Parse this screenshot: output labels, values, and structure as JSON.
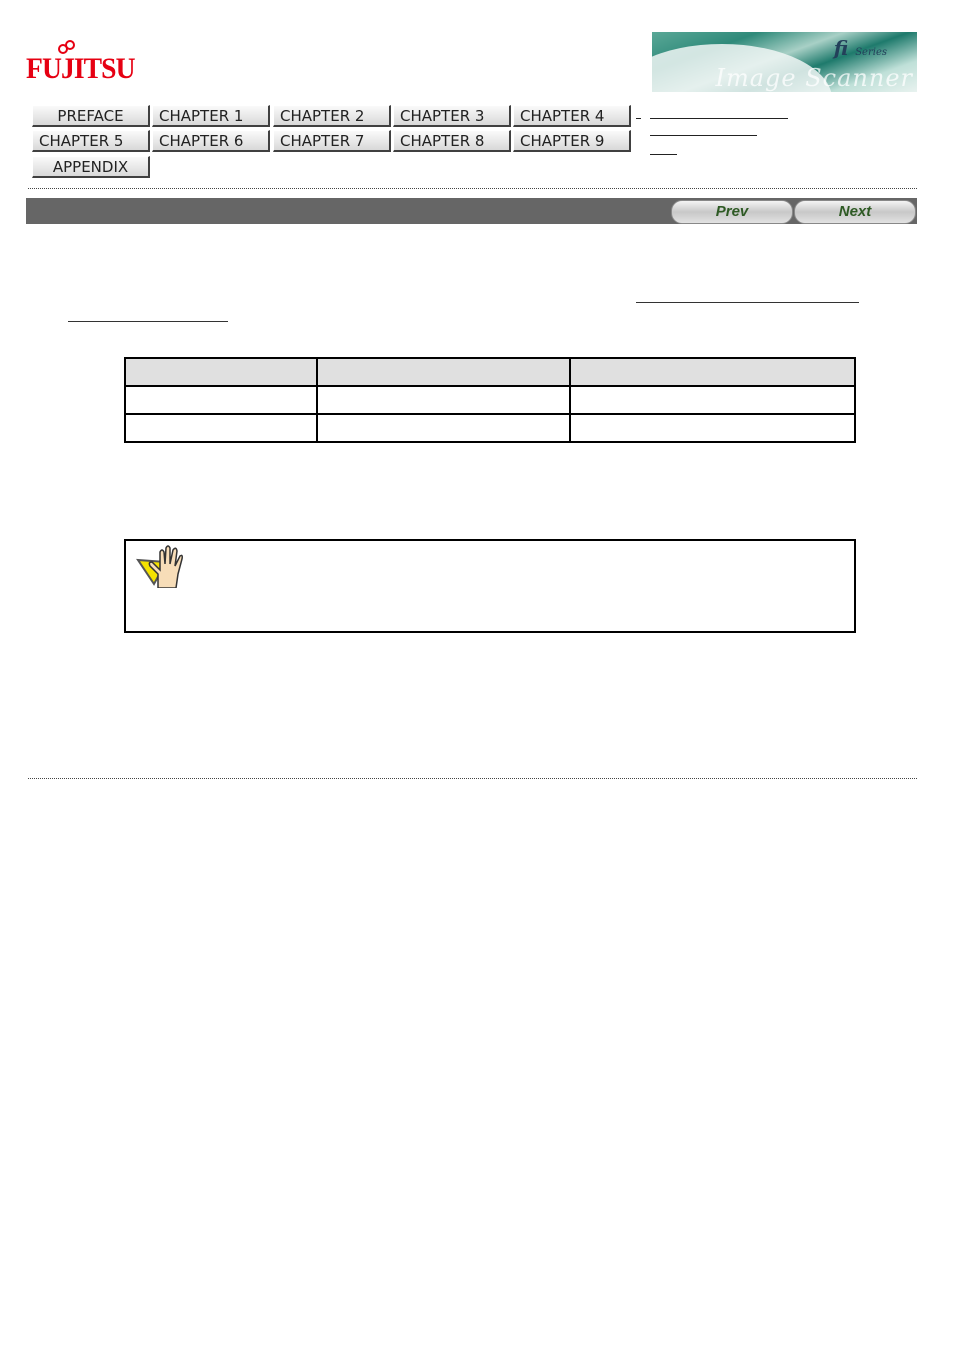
{
  "header": {
    "logo_text": "FUJITSU",
    "banner": {
      "brand": "fi",
      "series": "Series",
      "product": "Image Scanner"
    }
  },
  "nav": {
    "buttons": [
      {
        "label": "PREFACE"
      },
      {
        "label": "CHAPTER 1"
      },
      {
        "label": "CHAPTER 2"
      },
      {
        "label": "CHAPTER 3"
      },
      {
        "label": "CHAPTER 4"
      },
      {
        "label": "CHAPTER 5"
      },
      {
        "label": "CHAPTER 6"
      },
      {
        "label": "CHAPTER 7"
      },
      {
        "label": "CHAPTER 8"
      },
      {
        "label": "CHAPTER 9"
      },
      {
        "label": "APPENDIX"
      }
    ],
    "side_links": [
      {
        "label": ""
      },
      {
        "label": ""
      },
      {
        "label": ""
      }
    ]
  },
  "pager": {
    "prev_label": "Prev",
    "next_label": "Next"
  },
  "content": {
    "paragraph_link_1": "",
    "paragraph_link_2": "",
    "table": {
      "headers": [
        "",
        "",
        ""
      ],
      "rows": [
        [
          "",
          "",
          ""
        ],
        [
          "",
          "",
          ""
        ]
      ]
    },
    "note": {
      "icon": "attention-hand-icon",
      "text": ""
    }
  }
}
